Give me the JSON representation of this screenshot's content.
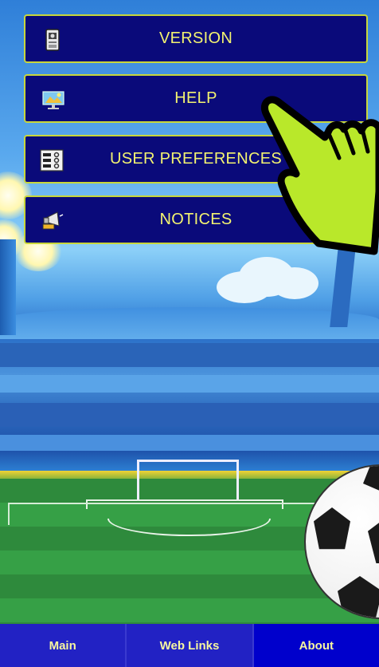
{
  "menu": {
    "items": [
      {
        "label": "VERSION",
        "icon": "phone-icon"
      },
      {
        "label": "HELP",
        "icon": "monitor-presentation-icon"
      },
      {
        "label": "USER PREFERENCES",
        "icon": "settings-panel-icon"
      },
      {
        "label": "NOTICES",
        "icon": "megaphone-icon"
      }
    ]
  },
  "bottom_nav": {
    "items": [
      {
        "label": "Main"
      },
      {
        "label": "Web Links"
      },
      {
        "label": "About"
      }
    ],
    "active": "About"
  },
  "colors": {
    "button_bg": "#0a0a7a",
    "button_border": "#c9d63a",
    "button_text": "#f3f370",
    "hand": "#b9e82a",
    "nav_bg": "#1b1bb0"
  }
}
